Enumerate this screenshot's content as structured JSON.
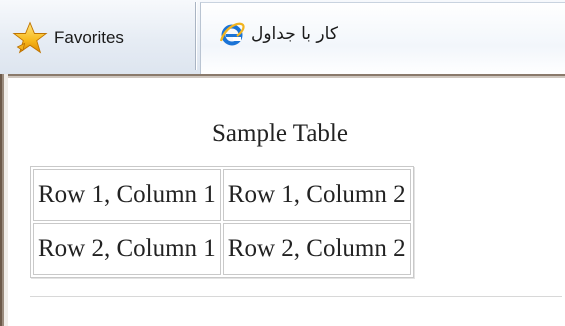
{
  "toolbar": {
    "favorites_label": "Favorites",
    "favorites_icon": "star-icon",
    "tab_title": "کار با جداول",
    "tab_icon": "internet-explorer-icon"
  },
  "page": {
    "caption": "Sample Table",
    "table": {
      "rows": [
        [
          "Row 1, Column 1",
          "Row 1, Column 2"
        ],
        [
          "Row 2, Column 1",
          "Row 2, Column 2"
        ]
      ]
    }
  },
  "colors": {
    "toolbar_bg": "#e6ecf4",
    "table_border": "#c9c9c9",
    "text": "#222222"
  }
}
